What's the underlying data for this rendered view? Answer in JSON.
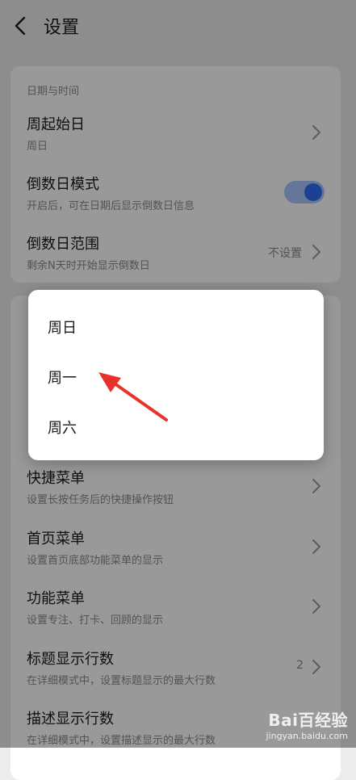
{
  "header": {
    "title": "设置"
  },
  "date_section": {
    "title": "日期与时间",
    "week_start": {
      "label": "周起始日",
      "sub": "周日"
    },
    "countdown_mode": {
      "label": "倒数日模式",
      "sub": "开启后，可在日期后显示倒数日信息",
      "enabled": true
    },
    "countdown_range": {
      "label": "倒数日范围",
      "sub": "剩余N天时开始显示倒数日",
      "value": "不设置"
    }
  },
  "menu_section": {
    "quick_menu": {
      "label": "快捷菜单",
      "sub": "设置长按任务后的快捷操作按钮"
    },
    "home_menu": {
      "label": "首页菜单",
      "sub": "设置首页底部功能菜单的显示"
    },
    "function_menu": {
      "label": "功能菜单",
      "sub": "设置专注、打卡、回顾的显示"
    },
    "title_lines": {
      "label": "标题显示行数",
      "sub": "在详细模式中，设置标题显示的最大行数",
      "value": "2"
    },
    "desc_lines": {
      "label": "描述显示行数",
      "sub": "在详细模式中，设置描述显示的最大行数"
    }
  },
  "dialog": {
    "options": [
      "周日",
      "周一",
      "周六"
    ]
  },
  "watermark": {
    "brand": "Bai百经验",
    "site": "jingyan.baidu.com"
  },
  "colors": {
    "accent": "#2f6bf3",
    "annotation": "#e8332c"
  },
  "icons": {
    "back": "chevron-left-icon",
    "row": "chevron-right-icon"
  }
}
